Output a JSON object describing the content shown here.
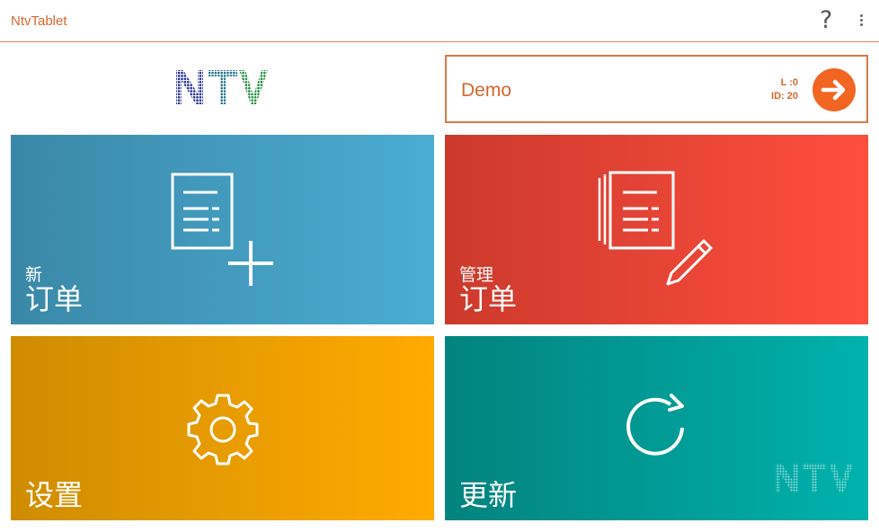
{
  "app": {
    "title": "NtvTablet"
  },
  "toolbar": {
    "help_icon": "?",
    "overflow_icon": "overflow-menu-icon"
  },
  "brand": {
    "logo_text": "NTV"
  },
  "user_card": {
    "name": "Demo",
    "level": "L :0",
    "id": "ID: 20",
    "action_icon": "arrow-right-icon",
    "accent": "#f26522"
  },
  "tiles": [
    {
      "small": "新",
      "big": "订单",
      "icon": "new-order-icon",
      "color": "#4aadd2"
    },
    {
      "small": "管理",
      "big": "订单",
      "icon": "manage-orders-icon",
      "color": "#ff4e3e"
    },
    {
      "small": "",
      "big": "设置",
      "icon": "gear-icon",
      "color": "#ffab00"
    },
    {
      "small": "",
      "big": "更新",
      "icon": "refresh-icon",
      "color": "#00b2ad",
      "watermark": "NTV"
    }
  ]
}
